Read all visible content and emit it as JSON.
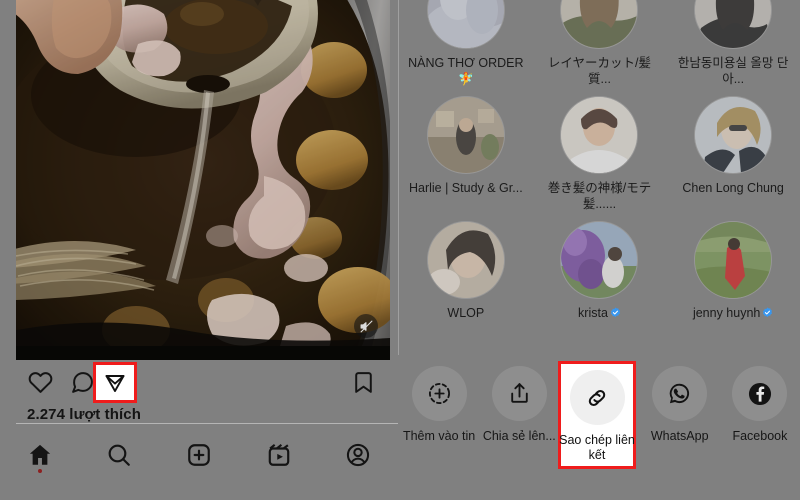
{
  "post": {
    "media_type": "video",
    "mute_icon": "speaker-muted-icon",
    "likes_text": "2.274 lượt thích",
    "actions": [
      {
        "name": "like",
        "icon": "heart-icon"
      },
      {
        "name": "comment",
        "icon": "comment-bubble-icon"
      },
      {
        "name": "share",
        "icon": "paper-plane-icon",
        "highlighted": true
      },
      {
        "name": "save",
        "icon": "bookmark-icon"
      }
    ]
  },
  "bottom_nav": [
    {
      "name": "home",
      "icon": "home-icon",
      "active": true
    },
    {
      "name": "search",
      "icon": "search-icon",
      "active": false
    },
    {
      "name": "create",
      "icon": "plus-square-icon",
      "active": false
    },
    {
      "name": "reels",
      "icon": "reels-icon",
      "active": false
    },
    {
      "name": "profile",
      "icon": "profile-circle-icon",
      "active": false
    }
  ],
  "people": [
    {
      "name": "NÀNG THƠ ORDER 🧚",
      "verified": false
    },
    {
      "name": "レイヤーカット/髪質...",
      "verified": false
    },
    {
      "name": "한남동미용실 올망 단아...",
      "verified": false
    },
    {
      "name": "Harlie | Study & Gr...",
      "verified": false
    },
    {
      "name": "巻き髪の神様/モテ髪......",
      "verified": false
    },
    {
      "name": "Chen Long Chung",
      "verified": false
    },
    {
      "name": "WLOP",
      "verified": false
    },
    {
      "name": "krista",
      "verified": true
    },
    {
      "name": "jenny huynh",
      "verified": true
    }
  ],
  "share_targets": [
    {
      "label": "Thêm vào tin",
      "icon": "add-to-story-icon",
      "highlighted": false
    },
    {
      "label": "Chia sẻ lên...",
      "icon": "share-up-icon",
      "highlighted": false
    },
    {
      "label": "Sao chép liên kết",
      "icon": "link-chain-icon",
      "highlighted": true
    },
    {
      "label": "WhatsApp",
      "icon": "whatsapp-icon",
      "highlighted": false
    },
    {
      "label": "Facebook",
      "icon": "facebook-icon",
      "highlighted": false
    }
  ],
  "colors": {
    "highlight": "#ef1c1c",
    "overlay_bg": "#808080",
    "verified_blue": "#3897f0",
    "active_dot": "#8c2020"
  }
}
